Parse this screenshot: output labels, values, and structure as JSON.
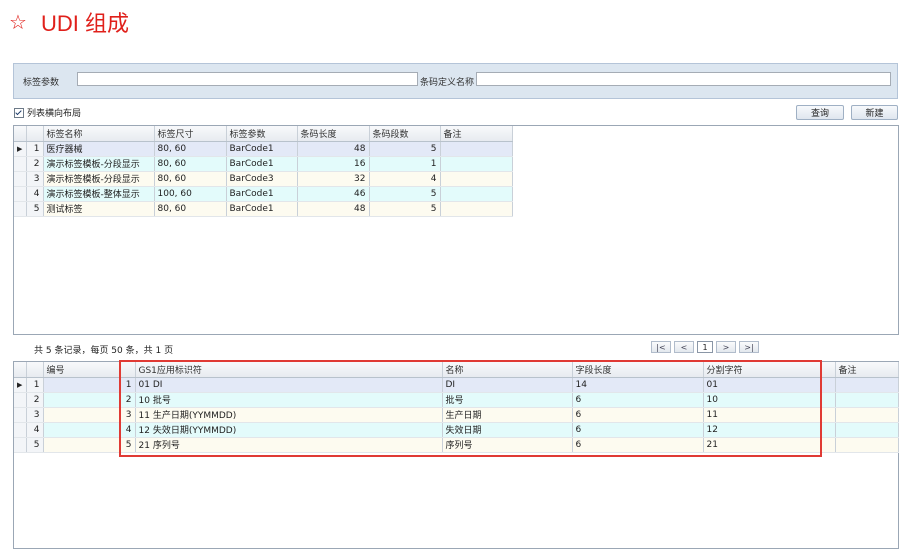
{
  "page": {
    "star": "☆",
    "title": "UDI 组成"
  },
  "filter": {
    "label_param_label": "标签参数",
    "label_param_value": "",
    "barcode_name_label": "条码定义名称",
    "barcode_name_value": ""
  },
  "toolbar": {
    "horizontal_layout_label": "列表横向布局",
    "horizontal_layout_checked": true,
    "query_label": "查询",
    "new_label": "新建"
  },
  "label_table": {
    "columns": [
      "标签名称",
      "标签尺寸",
      "标签参数",
      "条码长度",
      "条码段数",
      "备注"
    ],
    "rows": [
      {
        "rn": "1",
        "name": "医疗器械",
        "size": "80, 60",
        "param": "BarCode1",
        "length": "48",
        "segments": "5",
        "note": ""
      },
      {
        "rn": "2",
        "name": "演示标签模板-分段显示",
        "size": "80, 60",
        "param": "BarCode1",
        "length": "16",
        "segments": "1",
        "note": ""
      },
      {
        "rn": "3",
        "name": "演示标签模板-分段显示",
        "size": "80, 60",
        "param": "BarCode3",
        "length": "32",
        "segments": "4",
        "note": ""
      },
      {
        "rn": "4",
        "name": "演示标签模板-整体显示",
        "size": "100, 60",
        "param": "BarCode1",
        "length": "46",
        "segments": "5",
        "note": ""
      },
      {
        "rn": "5",
        "name": "测试标签",
        "size": "80, 60",
        "param": "BarCode1",
        "length": "48",
        "segments": "5",
        "note": ""
      }
    ]
  },
  "pager": {
    "summary": "共 5 条记录，每页 50 条，共 1 页",
    "first": "|<",
    "prev": "<",
    "page": "1",
    "next": ">",
    "last": ">|"
  },
  "segment_table": {
    "columns": [
      "编号",
      "GS1应用标识符",
      "名称",
      "字段长度",
      "分割字符",
      "备注"
    ],
    "rows": [
      {
        "rn": "1",
        "no": "1",
        "ai": "01 DI",
        "name": "DI",
        "length": "14",
        "sep": "01",
        "note": ""
      },
      {
        "rn": "2",
        "no": "2",
        "ai": "10 批号",
        "name": "批号",
        "length": "6",
        "sep": "10",
        "note": ""
      },
      {
        "rn": "3",
        "no": "3",
        "ai": "11 生产日期(YYMMDD)",
        "name": "生产日期",
        "length": "6",
        "sep": "11",
        "note": ""
      },
      {
        "rn": "4",
        "no": "4",
        "ai": "12 失效日期(YYMMDD)",
        "name": "失效日期",
        "length": "6",
        "sep": "12",
        "note": ""
      },
      {
        "rn": "5",
        "no": "5",
        "ai": "21 序列号",
        "name": "序列号",
        "length": "6",
        "sep": "21",
        "note": ""
      }
    ]
  },
  "colors": {
    "title": "#e0201b",
    "highlight_box": "#e03a34",
    "filter_bg": "#dce6f0"
  }
}
